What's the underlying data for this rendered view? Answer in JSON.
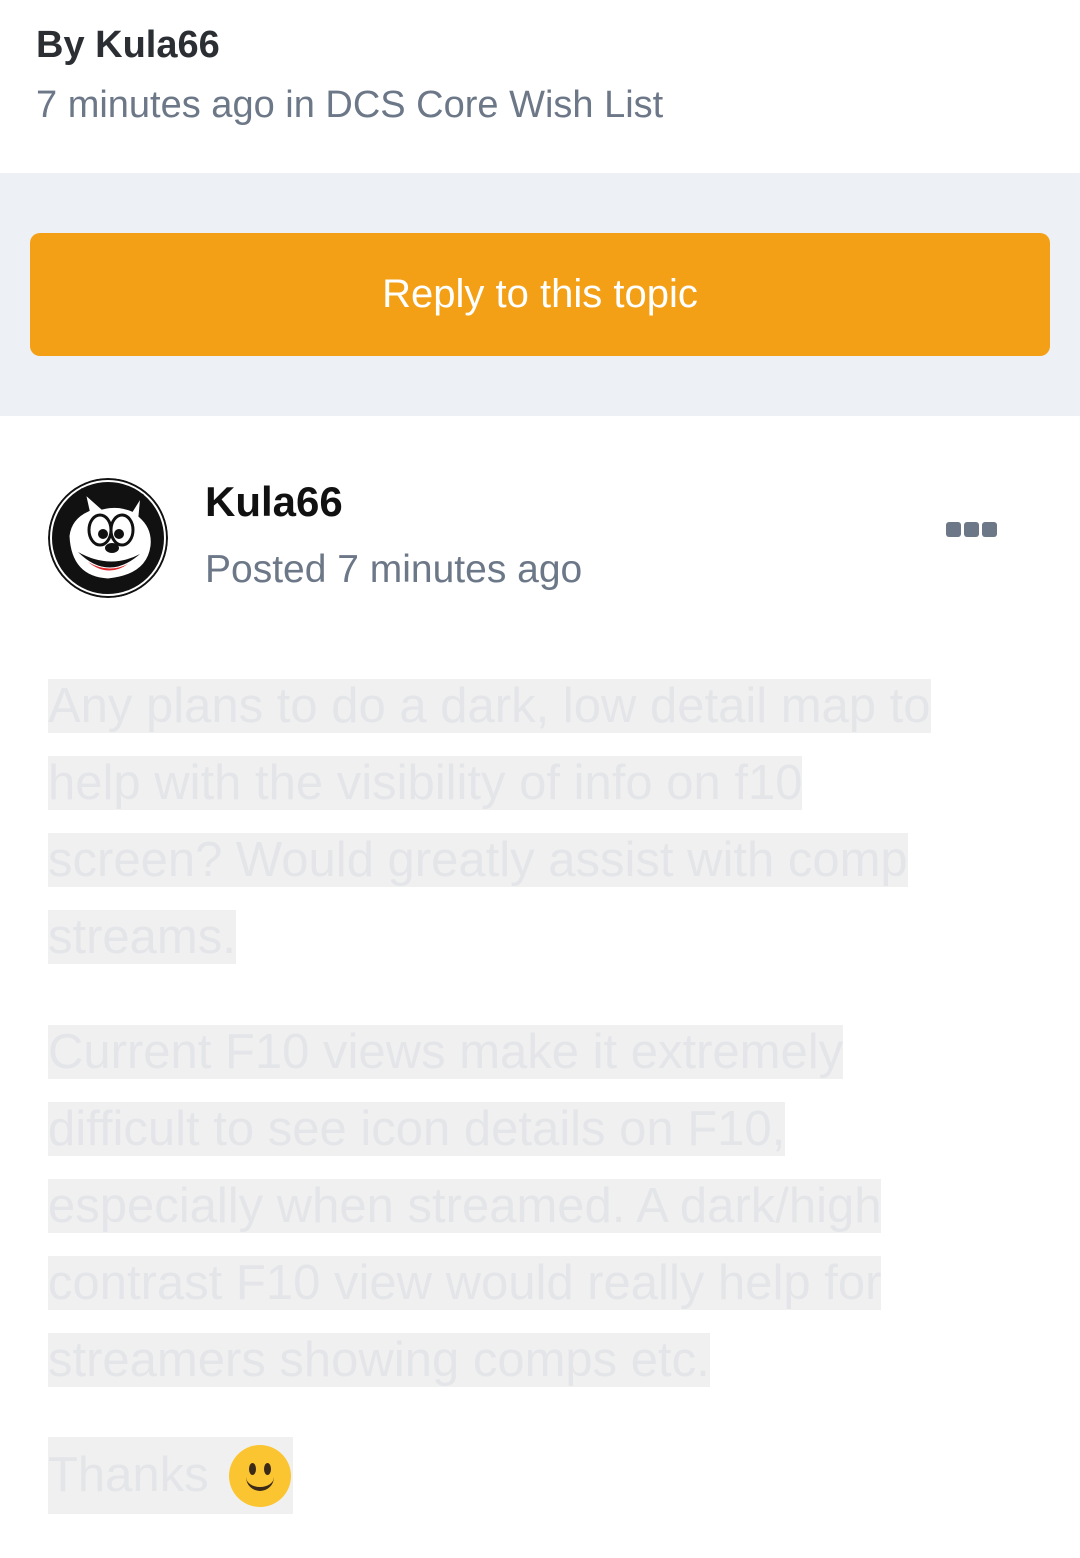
{
  "topic": {
    "author_line": "By Kula66",
    "meta_line": "7 minutes ago in DCS Core Wish List"
  },
  "reply_button": {
    "label": "Reply to this topic"
  },
  "post": {
    "author": "Kula66",
    "posted": "Posted 7 minutes ago",
    "paragraphs": [
      "Any plans to do a dark, low detail map to help with the visibility of info on f10 screen? Would greatly assist with comp streams.",
      "Current F10 views make it extremely difficult to see icon details on F10, especially when streamed. A dark/high contrast F10 view would really help for streamers showing comps etc."
    ],
    "thanks": "Thanks"
  },
  "colors": {
    "accent": "#f3a016",
    "muted_text": "#6c7787",
    "band_bg": "#edf0f4"
  },
  "icons": [
    "more-options-icon",
    "smiley-emoji-icon"
  ]
}
